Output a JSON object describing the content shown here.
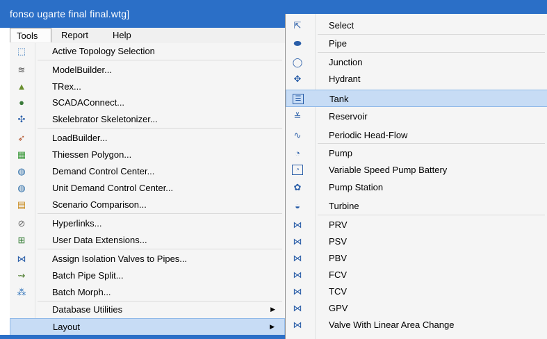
{
  "window": {
    "title": "fonso ugarte final final.wtg]"
  },
  "menubar": {
    "tools": "Tools",
    "report": "Report",
    "help": "Help"
  },
  "tools_menu": [
    {
      "icon": "topology-selection-icon",
      "glyph": "⬚",
      "label": "Active Topology Selection",
      "color": "#2a6fb8"
    },
    {
      "icon": "modelbuilder-icon",
      "glyph": "≋",
      "label": "ModelBuilder...",
      "color": "#555555"
    },
    {
      "icon": "trex-icon",
      "glyph": "▲",
      "label": "TRex...",
      "color": "#6a8f2f"
    },
    {
      "icon": "scadaconnect-icon",
      "glyph": "●",
      "label": "SCADAConnect...",
      "color": "#3a7a3a"
    },
    {
      "icon": "skelebrator-icon",
      "glyph": "✣",
      "label": "Skelebrator Skeletonizer...",
      "color": "#2a5ea8"
    },
    {
      "icon": "loadbuilder-icon",
      "glyph": "➶",
      "label": "LoadBuilder...",
      "color": "#b0522a"
    },
    {
      "icon": "thiessen-polygon-icon",
      "glyph": "▦",
      "label": "Thiessen Polygon...",
      "color": "#3d9a3d"
    },
    {
      "icon": "demand-control-icon",
      "glyph": "◍",
      "label": "Demand Control Center...",
      "color": "#2f6fa8"
    },
    {
      "icon": "unit-demand-control-icon",
      "glyph": "◍",
      "label": "Unit Demand Control Center...",
      "color": "#2f6fa8"
    },
    {
      "icon": "scenario-comparison-icon",
      "glyph": "▤",
      "label": "Scenario Comparison...",
      "color": "#c98a1e"
    },
    {
      "icon": "hyperlinks-icon",
      "glyph": "⊘",
      "label": "Hyperlinks...",
      "color": "#666666"
    },
    {
      "icon": "user-data-extensions-icon",
      "glyph": "⊞",
      "label": "User Data Extensions...",
      "color": "#2f7a2f"
    },
    {
      "icon": "isolation-valves-icon",
      "glyph": "⋈",
      "label": "Assign Isolation Valves to Pipes...",
      "color": "#2a5ea8"
    },
    {
      "icon": "batch-pipe-split-icon",
      "glyph": "⇝",
      "label": "Batch Pipe Split...",
      "color": "#4a7a2a"
    },
    {
      "icon": "batch-morph-icon",
      "glyph": "⁂",
      "label": "Batch Morph...",
      "color": "#2a6fb8"
    },
    {
      "icon": "database-utilities-icon",
      "glyph": "",
      "label": "Database Utilities",
      "color": "#000000"
    },
    {
      "icon": "layout-icon",
      "glyph": "",
      "label": "Layout",
      "color": "#000000"
    }
  ],
  "layout_menu": [
    {
      "icon": "select-icon",
      "glyph": "⇱",
      "label": "Select"
    },
    {
      "icon": "pipe-icon",
      "glyph": "⬬",
      "label": "Pipe"
    },
    {
      "icon": "junction-icon",
      "glyph": "◯",
      "label": "Junction"
    },
    {
      "icon": "hydrant-icon",
      "glyph": "✥",
      "label": "Hydrant"
    },
    {
      "icon": "tank-icon",
      "glyph": "☰",
      "label": "Tank"
    },
    {
      "icon": "reservoir-icon",
      "glyph": "≚",
      "label": "Reservoir"
    },
    {
      "icon": "periodic-head-flow-icon",
      "glyph": "∿",
      "label": "Periodic Head-Flow"
    },
    {
      "icon": "pump-icon",
      "glyph": "◔",
      "label": "Pump"
    },
    {
      "icon": "variable-speed-pump-battery-icon",
      "glyph": "◔",
      "label": "Variable Speed Pump Battery"
    },
    {
      "icon": "pump-station-icon",
      "glyph": "✿",
      "label": "Pump Station"
    },
    {
      "icon": "turbine-icon",
      "glyph": "◒",
      "label": "Turbine"
    },
    {
      "icon": "prv-icon",
      "glyph": "⋈",
      "label": "PRV"
    },
    {
      "icon": "psv-icon",
      "glyph": "⋈",
      "label": "PSV"
    },
    {
      "icon": "pbv-icon",
      "glyph": "⋈",
      "label": "PBV"
    },
    {
      "icon": "fcv-icon",
      "glyph": "⋈",
      "label": "FCV"
    },
    {
      "icon": "tcv-icon",
      "glyph": "⋈",
      "label": "TCV"
    },
    {
      "icon": "gpv-icon",
      "glyph": "⋈",
      "label": "GPV"
    },
    {
      "icon": "valve-linear-area-change-icon",
      "glyph": "⋈",
      "label": "Valve With Linear Area Change"
    }
  ],
  "colors": {
    "title_bar": "#2b6fc7",
    "highlight": "#c7dcf5",
    "highlight_border": "#90b9e8",
    "menu_bg": "#f5f5f5"
  }
}
